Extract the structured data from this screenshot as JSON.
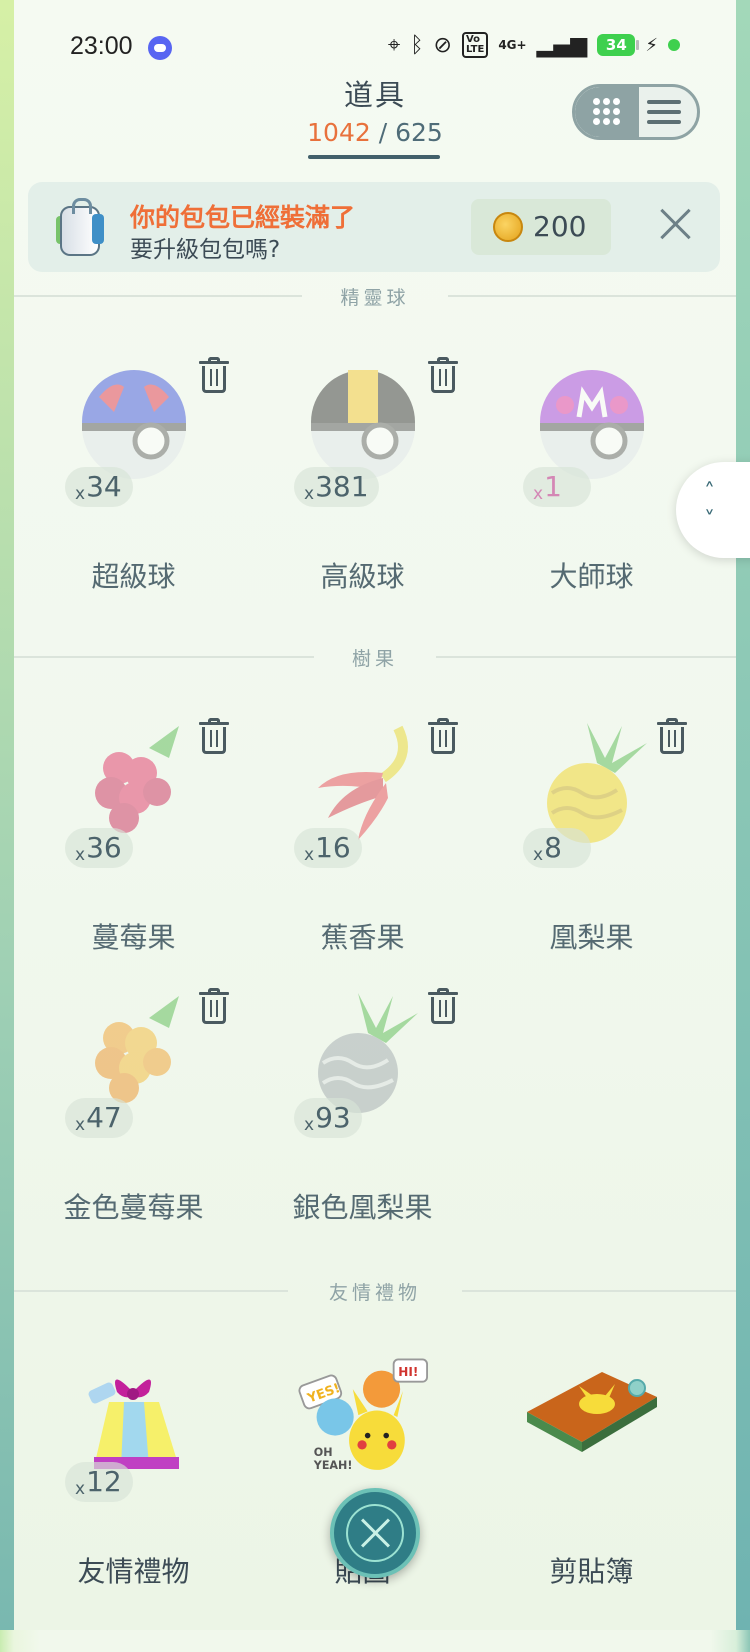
{
  "status_bar": {
    "time": "23:00",
    "battery": "34",
    "network": "4G+",
    "icons": [
      "discord-icon",
      "location-icon",
      "bluetooth-icon",
      "vibrate-off-icon",
      "volte-icon",
      "signal-icon",
      "battery-icon",
      "charging-icon"
    ]
  },
  "header": {
    "title": "道具",
    "current_count": "1042",
    "separator": "/",
    "max_count": "625"
  },
  "banner": {
    "line1": "你的包包已經裝滿了",
    "line2": "要升級包包嗎?",
    "coin_amount": "200"
  },
  "sections": [
    {
      "label": "精靈球",
      "items": [
        {
          "name": "超級球",
          "count": "34"
        },
        {
          "name": "高級球",
          "count": "381"
        },
        {
          "name": "大師球",
          "count": "1"
        }
      ]
    },
    {
      "label": "樹果",
      "items": [
        {
          "name": "蔓莓果",
          "count": "36"
        },
        {
          "name": "蕉香果",
          "count": "16"
        },
        {
          "name": "凰梨果",
          "count": "8"
        },
        {
          "name": "金色蔓莓果",
          "count": "47"
        },
        {
          "name": "銀色凰梨果",
          "count": "93"
        }
      ]
    },
    {
      "label": "友情禮物",
      "items": [
        {
          "name": "友情禮物",
          "count": "12"
        },
        {
          "name": "貼圖",
          "count": ""
        },
        {
          "name": "剪貼簿",
          "count": ""
        }
      ]
    }
  ],
  "count_prefix": "x",
  "colors": {
    "accent_orange": "#ef6f38",
    "text_dark": "#3c4b55",
    "fab": "#2f7d86",
    "battery": "#3ed04e"
  }
}
